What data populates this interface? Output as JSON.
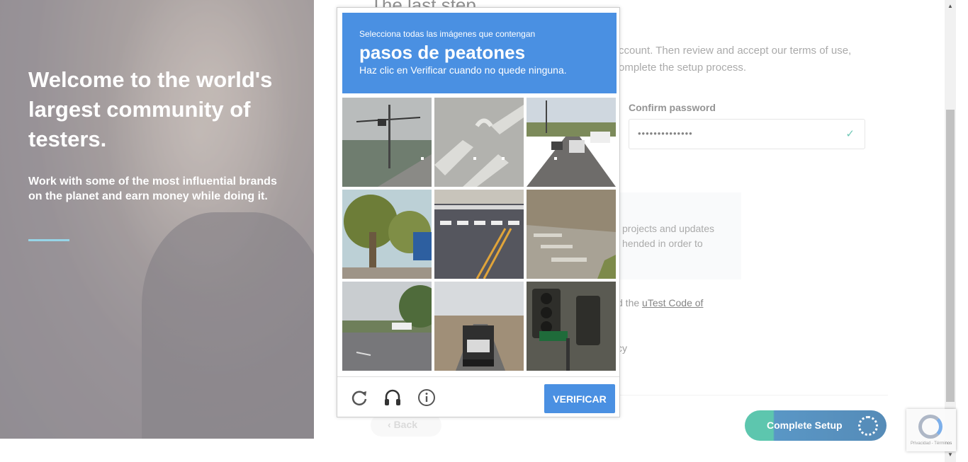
{
  "hero": {
    "title": "Welcome to the world's largest community of testers.",
    "subtitle": "Work with some of the most influential brands on the planet and earn money while doing it."
  },
  "form": {
    "heading": "The last step",
    "intro_line1": "ccount. Then review and accept our terms of use,",
    "intro_line2": "omplete the setup process.",
    "confirm_password_label": "Confirm password",
    "confirm_password_value": "••••••••••••••",
    "note_line1": "projects and updates",
    "note_line2": "hended in order to",
    "code_prefix": "d the ",
    "code_link": "uTest Code of",
    "privacy_fragment": "cy",
    "back_label": "Back",
    "complete_label": "Complete Setup"
  },
  "captcha": {
    "instruction": "Selecciona todas las imágenes que contengan",
    "target": "pasos de peatones",
    "hint": "Haz clic en Verificar cuando no quede ninguna.",
    "verify_label": "VERIFICAR",
    "tiles": [
      {
        "name": "tile-road-traffic-light",
        "bg": "#7d8a84"
      },
      {
        "name": "tile-crosswalk-closeup",
        "bg": "#b4b4b0"
      },
      {
        "name": "tile-street-cars",
        "bg": "#a9a49c"
      },
      {
        "name": "tile-palm-trees",
        "bg": "#7f8a4f"
      },
      {
        "name": "tile-crosswalk-road",
        "bg": "#5d5e66"
      },
      {
        "name": "tile-crosswalk-street",
        "bg": "#9d8f79"
      },
      {
        "name": "tile-highway",
        "bg": "#a3a8ab"
      },
      {
        "name": "tile-truck",
        "bg": "#9b978e"
      },
      {
        "name": "tile-traffic-lights-sign",
        "bg": "#4a4a44"
      }
    ]
  },
  "badge": {
    "text": "Privacidad - Términos"
  },
  "colors": {
    "accent": "#4a90e2",
    "teal": "#1fb08f",
    "navy": "#155f9c"
  }
}
